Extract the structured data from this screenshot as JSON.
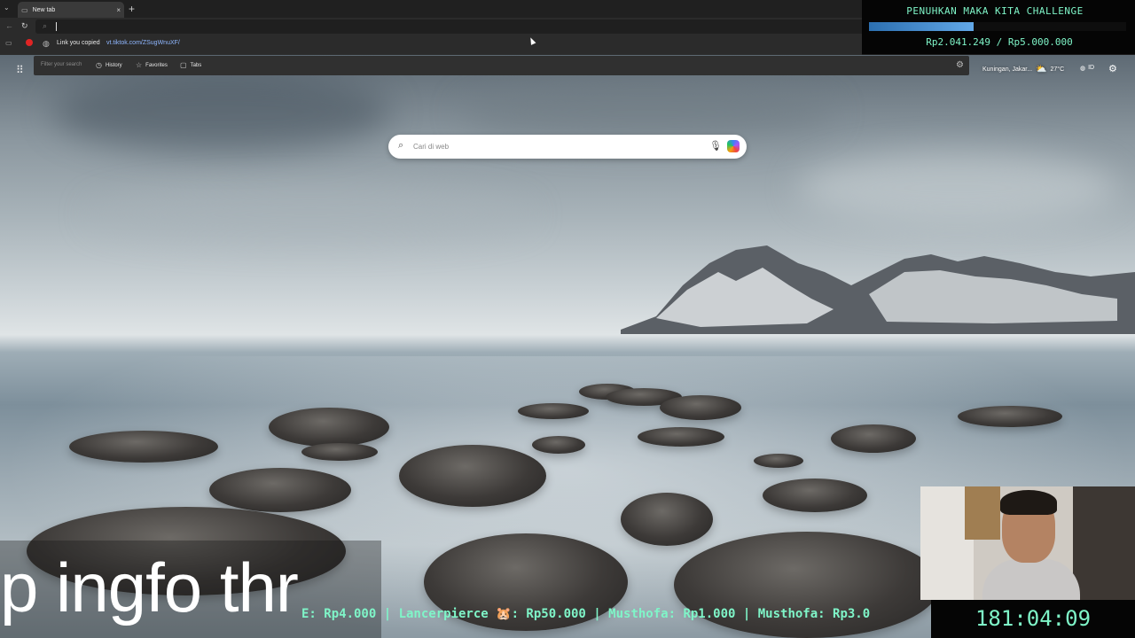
{
  "browser": {
    "tab_title": "New tab",
    "tab_close": "×",
    "new_tab": "+",
    "address_value": "",
    "suggestion_label": "Link you copied",
    "suggestion_url": "vt.tiktok.com/ZSugWnuXF/"
  },
  "quickbar": {
    "filter_placeholder": "Filter your search",
    "items": [
      {
        "label": "History",
        "icon": "history-icon"
      },
      {
        "label": "Favorites",
        "icon": "star-icon"
      },
      {
        "label": "Tabs",
        "icon": "tabs-icon"
      }
    ]
  },
  "header": {
    "weather_location": "Kuningan, Jakar...",
    "weather_temp": "27°C",
    "language": "ID"
  },
  "search": {
    "placeholder": "Cari di web"
  },
  "overlay": {
    "challenge_title": "PENUHKAN MAKA KITA CHALLENGE",
    "challenge_amount": "Rp2.041.249 / Rp5.000.000",
    "challenge_progress": 0.408,
    "caption": "p ingfo thr",
    "ticker": "E: Rp4.000 | Lancerpierce 🐹: Rp50.000 | Musthofa: Rp1.000 | Musthofa: Rp3.0",
    "timer": "181:04:09"
  },
  "colors": {
    "overlay_accent": "#7ff5c8",
    "progress_fill": "#4a90d0"
  }
}
